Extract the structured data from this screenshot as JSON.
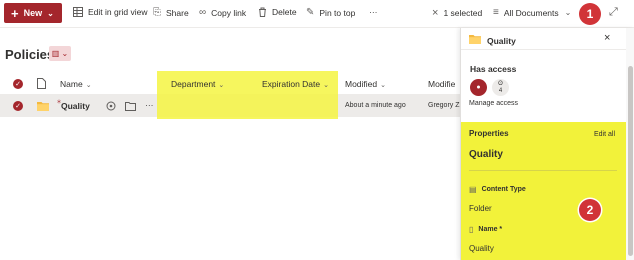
{
  "toolbar": {
    "new_label": "New",
    "edit_grid_label": "Edit in grid view",
    "share_label": "Share",
    "copy_link_label": "Copy link",
    "delete_label": "Delete",
    "pin_label": "Pin to top",
    "more_label": "···",
    "selected_label": "1 selected",
    "view_label": "All Documents",
    "badge1": "1"
  },
  "page": {
    "title": "Policies"
  },
  "list": {
    "columns": {
      "name": "Name",
      "department": "Department",
      "expiration": "Expiration Date",
      "modified": "Modified",
      "modified_by": "Modifie"
    },
    "row": {
      "name": "Quality",
      "more": "···",
      "modified": "About a minute ago",
      "modified_by": "Gregory Z"
    }
  },
  "panel": {
    "title": "Quality",
    "has_access": "Has access",
    "avatar_count": "4",
    "manage_access": "Manage access",
    "properties_label": "Properties",
    "edit_all": "Edit all",
    "item_name": "Quality",
    "content_type_label": "Content Type",
    "content_type_value": "Folder",
    "name_label": "Name *",
    "name_value": "Quality",
    "badge2": "2"
  },
  "colors": {
    "accent": "#a4262c",
    "highlight": "#f2f23a",
    "badge": "#d13438"
  }
}
